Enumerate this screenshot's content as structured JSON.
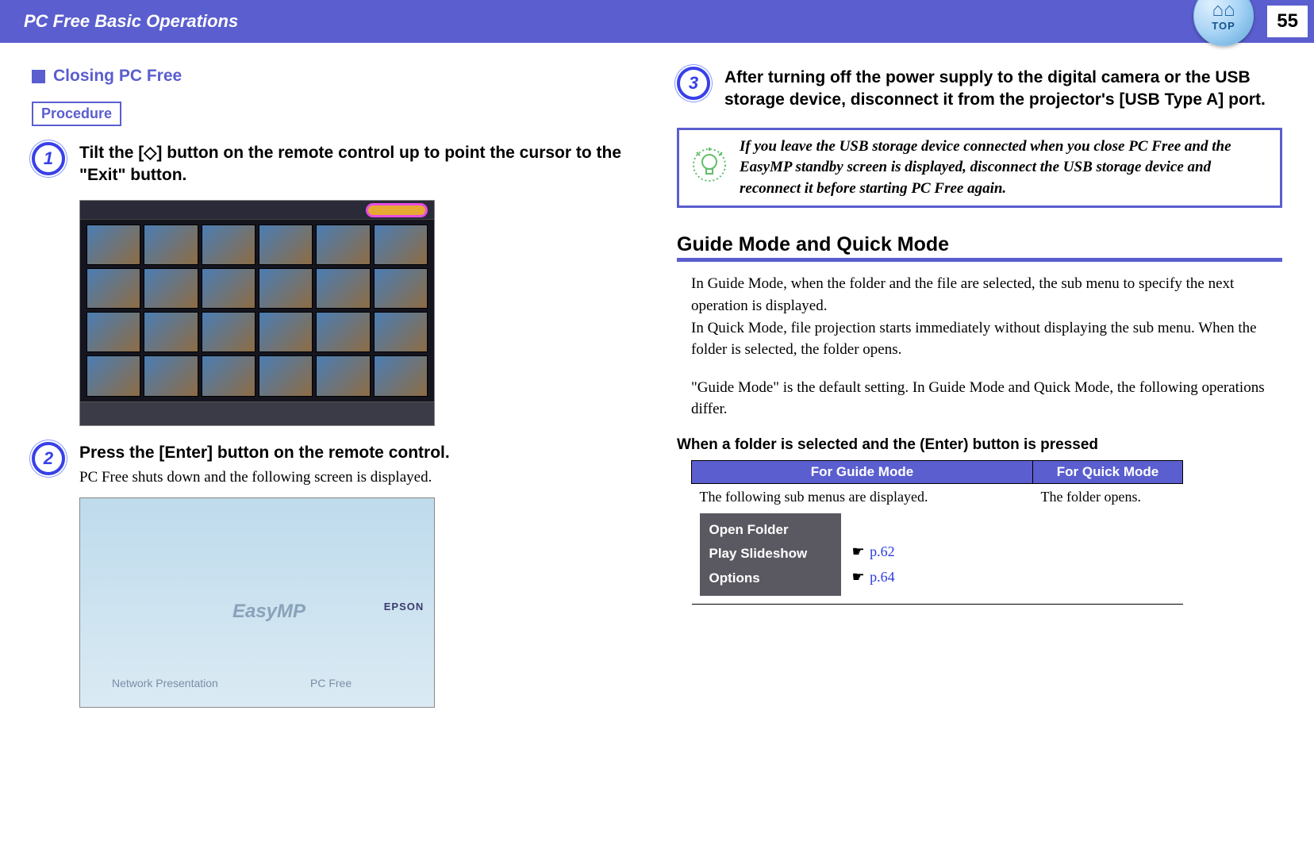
{
  "header": {
    "title": "PC Free Basic Operations",
    "page_number": "55",
    "top_badge_label": "TOP"
  },
  "left": {
    "section_title": "Closing PC Free",
    "procedure_label": "Procedure",
    "steps": {
      "1": {
        "num": "1",
        "title": "Tilt the [◇] button on the remote control up to point the cursor to the \"Exit\" button."
      },
      "2": {
        "num": "2",
        "title": "Press the [Enter] button on the remote control.",
        "desc": "PC Free shuts down and the following screen is displayed."
      }
    },
    "shot2": {
      "logo": "EasyMP",
      "brand": "EPSON",
      "net": "Network Presentation",
      "pcf": "PC Free"
    }
  },
  "right": {
    "step3": {
      "num": "3",
      "title": "After turning off the power supply to the digital camera or the USB storage device, disconnect it from the projector's [USB Type A] port."
    },
    "tip": "If you leave the USB storage device connected when you close PC Free and the EasyMP standby screen is displayed, disconnect the USB storage device and reconnect it before starting PC Free again.",
    "h2": "Guide Mode and Quick Mode",
    "para1": "In Guide Mode, when the folder and the file are selected, the sub menu to specify the next operation is displayed.",
    "para2": "In Quick Mode, file projection starts immediately without displaying the sub menu. When the folder is selected, the folder opens.",
    "para3": "\"Guide Mode\" is the default setting. In Guide Mode and Quick Mode, the following operations differ.",
    "table_caption": "When a folder is selected and the (Enter) button is pressed",
    "table": {
      "h_guide": "For Guide Mode",
      "h_quick": "For Quick Mode",
      "guide_text": "The following sub menus are displayed.",
      "quick_text": "The folder opens.",
      "submenu": {
        "open": "Open Folder",
        "play": "Play Slideshow",
        "options": "Options"
      },
      "refs": {
        "r1": "p.62",
        "r2": "p.64",
        "mark": "☛"
      }
    }
  }
}
